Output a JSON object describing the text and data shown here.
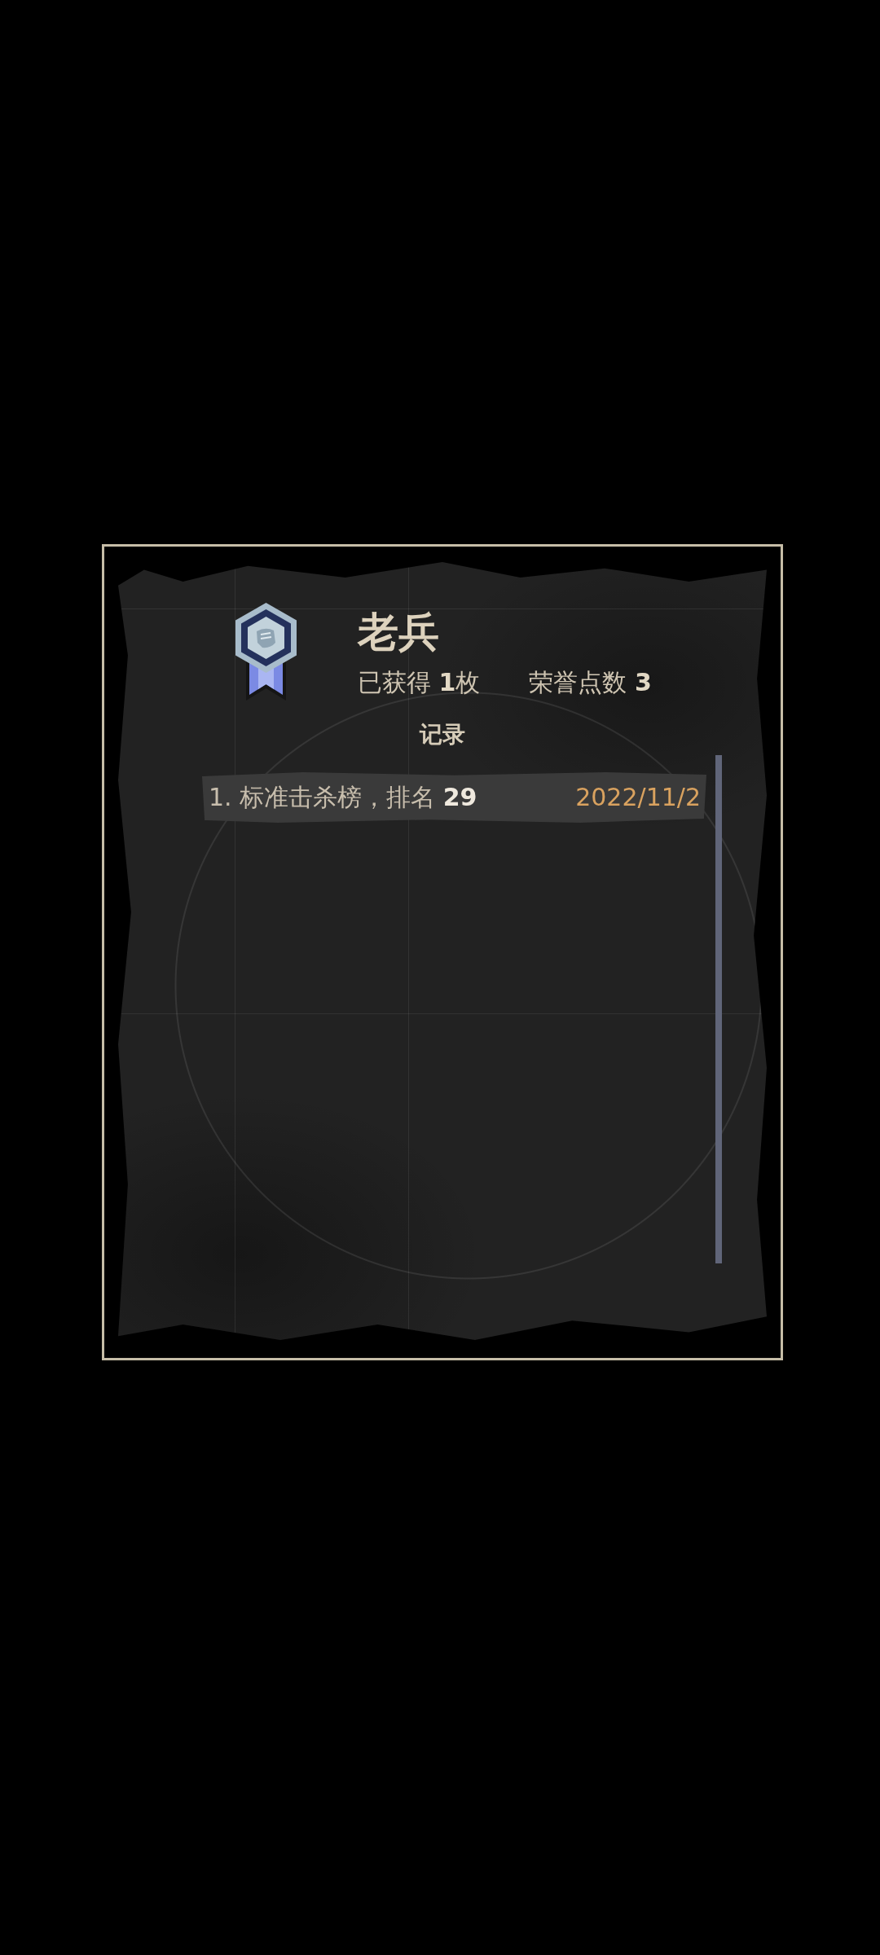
{
  "badge": {
    "title": "老兵",
    "stats": [
      {
        "text": "已获得 **1**枚"
      },
      {
        "text": "荣誉点数 **3**"
      }
    ]
  },
  "records": {
    "heading": "记录",
    "items": [
      {
        "text": "1. 标准击杀榜，排名 **29**",
        "date": "2022/11/2"
      }
    ]
  }
}
